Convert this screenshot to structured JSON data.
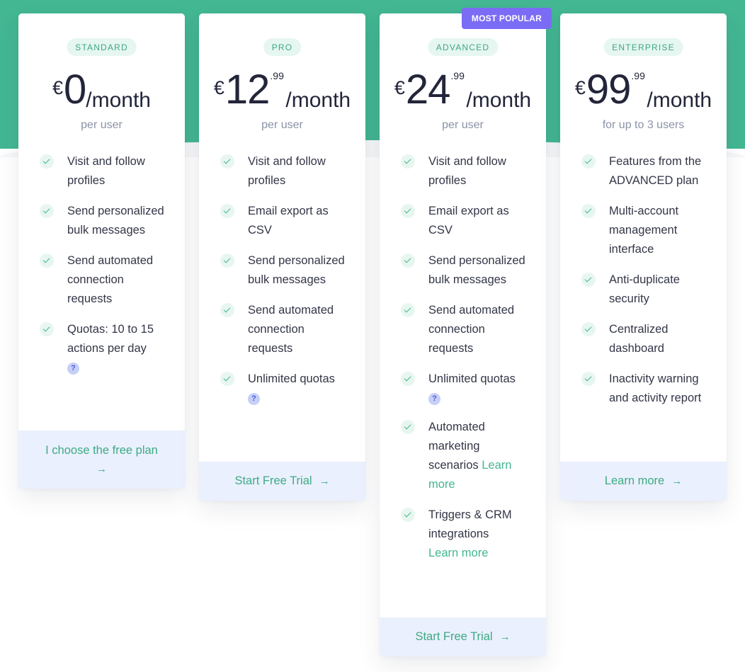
{
  "colors": {
    "brand_green": "#43b692",
    "popular_purple": "#7b6cf6",
    "cta_bg": "#eaf0fd"
  },
  "plans": [
    {
      "badge": "STANDARD",
      "currency": "€",
      "amount": "0",
      "cents": "",
      "period": "/month",
      "subtitle": "per user",
      "features": [
        {
          "text": "Visit and follow profiles"
        },
        {
          "text": "Send personalized bulk messages"
        },
        {
          "text": "Send automated connection requests"
        },
        {
          "text": "Quotas: 10 to 15 actions per day",
          "help": "?"
        }
      ],
      "cta": "I choose the free plan",
      "cta_arrow": "→"
    },
    {
      "badge": "PRO",
      "currency": "€",
      "amount": "12",
      "cents": ".99",
      "period": "/month",
      "subtitle": "per user",
      "features": [
        {
          "text": "Visit and follow profiles"
        },
        {
          "text": "Email export as CSV"
        },
        {
          "text": "Send personalized bulk messages"
        },
        {
          "text": "Send automated connection requests"
        },
        {
          "text": "Unlimited quotas",
          "help": "?"
        }
      ],
      "cta": "Start Free Trial",
      "cta_arrow": "→"
    },
    {
      "badge": "ADVANCED",
      "popular": "MOST POPULAR",
      "currency": "€",
      "amount": "24",
      "cents": ".99",
      "period": "/month",
      "subtitle": "per user",
      "features": [
        {
          "text": "Visit and follow profiles"
        },
        {
          "text": "Email export as CSV"
        },
        {
          "text": "Send personalized bulk messages"
        },
        {
          "text": "Send automated connection requests"
        },
        {
          "text": "Unlimited quotas",
          "help": "?"
        },
        {
          "text": "Automated marketing scenarios",
          "link": "Learn more"
        },
        {
          "text": "Triggers & CRM integrations",
          "link": "Learn more"
        }
      ],
      "cta": "Start Free Trial",
      "cta_arrow": "→"
    },
    {
      "badge": "ENTERPRISE",
      "currency": "€",
      "amount": "99",
      "cents": ".99",
      "period": "/month",
      "subtitle": "for up to 3 users",
      "features": [
        {
          "text": "Features from the ADVANCED plan"
        },
        {
          "text": "Multi-account management interface"
        },
        {
          "text": "Anti-duplicate security"
        },
        {
          "text": "Centralized dashboard"
        },
        {
          "text": "Inactivity warning and activity report"
        }
      ],
      "cta": "Learn more",
      "cta_arrow": "→"
    }
  ]
}
